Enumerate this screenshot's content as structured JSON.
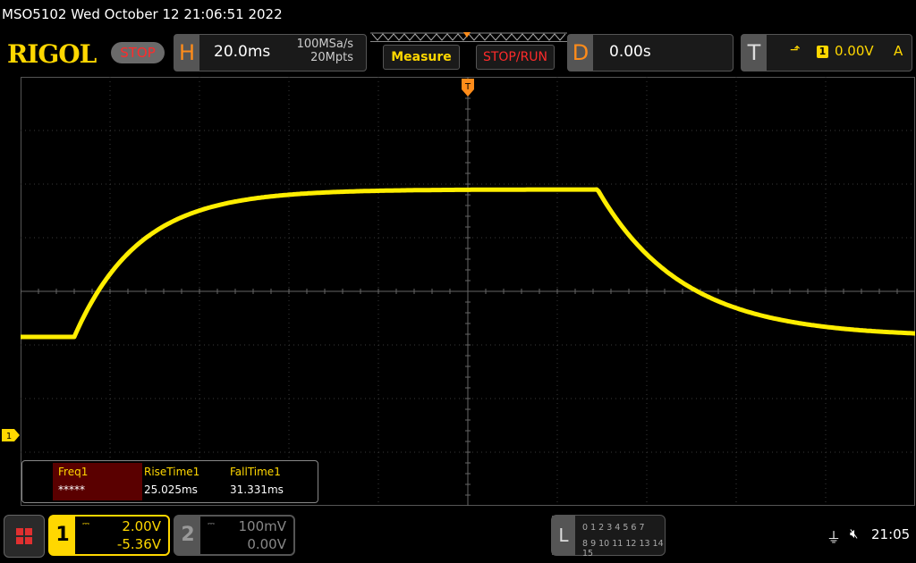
{
  "titlebar": {
    "text": "MSO5102  Wed October 12 21:06:51 2022"
  },
  "toolbar": {
    "logo": "RIGOL",
    "status": "STOP",
    "horizontal": {
      "letter": "H",
      "timebase": "20.0ms",
      "sample_rate": "100MSa/s",
      "memory_depth": "20Mpts"
    },
    "measure_label": "Measure",
    "stoprun_label": "STOP/RUN",
    "delay": {
      "letter": "D",
      "value": "0.00s"
    },
    "trigger": {
      "letter": "T",
      "source": "1",
      "level": "0.00V",
      "mode": "A"
    }
  },
  "waveform": {
    "channel": "1",
    "color": "#ffee00",
    "grid_divisions": {
      "horizontal": 10,
      "vertical": 8
    },
    "volts_per_div": 2.0,
    "time_per_div_ms": 20.0,
    "low_level_div": 3.15,
    "high_level_div": 5.9,
    "rise_start_div": 0.6,
    "fall_start_div": 6.45
  },
  "measurements": [
    {
      "name": "Freq1",
      "value": "*****",
      "active": true
    },
    {
      "name": "RiseTime1",
      "value": "25.025ms",
      "active": false
    },
    {
      "name": "FallTime1",
      "value": "31.331ms",
      "active": false
    }
  ],
  "channels": [
    {
      "number": "1",
      "coupling": "DC",
      "scale": "2.00V",
      "offset": "-5.36V",
      "enabled": true
    },
    {
      "number": "2",
      "coupling": "DC",
      "scale": "100mV",
      "offset": "0.00V",
      "enabled": false
    }
  ],
  "logic_analyzer": {
    "letter": "L",
    "row1": "0 1 2 3  4 5 6 7",
    "row2": "8 9 10 11 12 13 14 15"
  },
  "statusbar": {
    "clock": "21:05"
  },
  "colors": {
    "accent": "#ffd700",
    "stop": "#ff2b2b",
    "timebase": "#ff8c1a",
    "trace": "#ffee00"
  }
}
